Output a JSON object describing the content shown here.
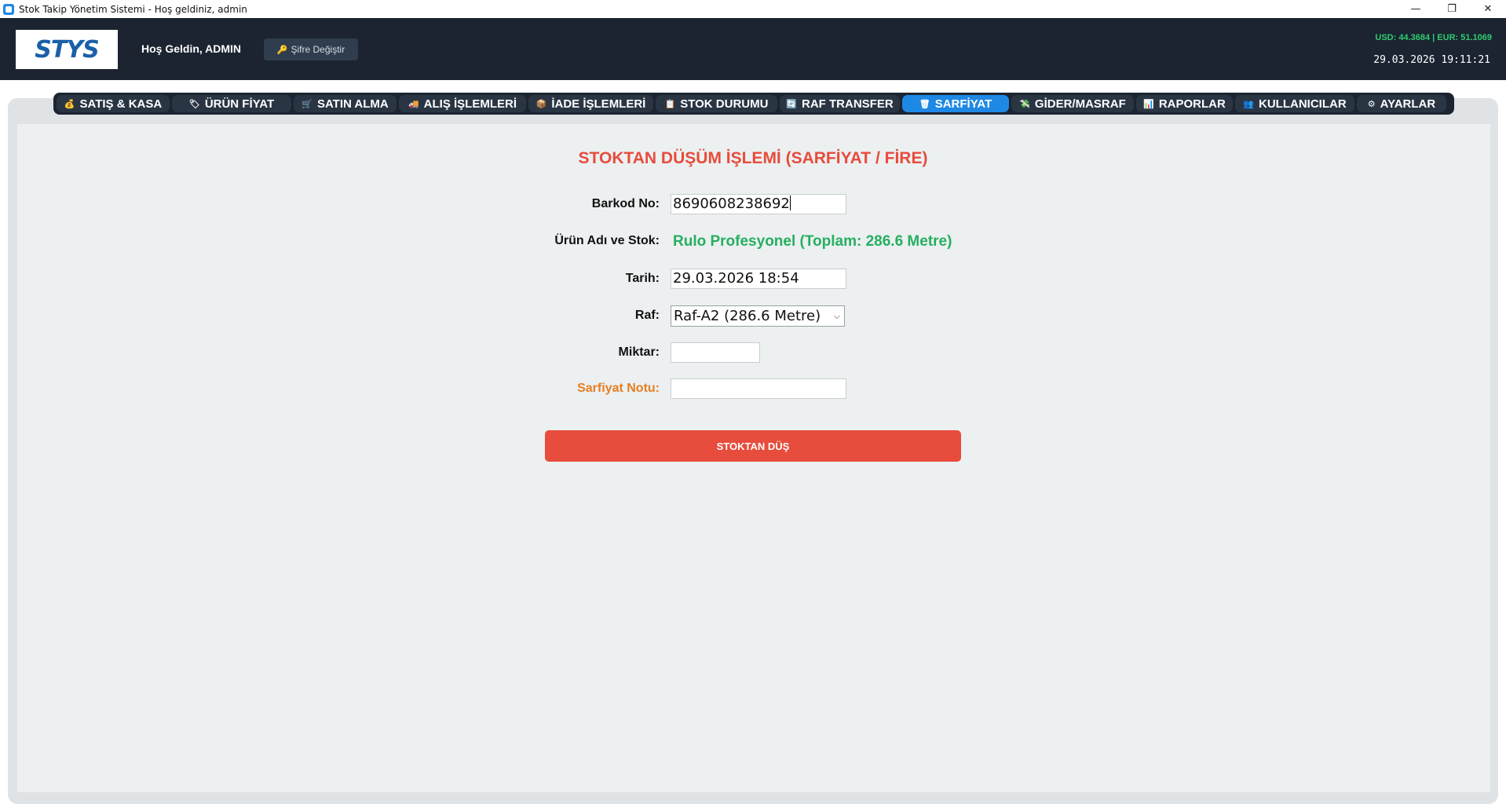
{
  "window": {
    "title": "Stok Takip Yönetim Sistemi - Hoş geldiniz, admin",
    "controls": {
      "minimize": "—",
      "restore": "❐",
      "close": "✕"
    }
  },
  "header": {
    "logo": "STYS",
    "welcome": "Hoş Geldin, ADMIN",
    "change_password": "Şifre Değiştir",
    "currency": "USD: 44.3684 | EUR: 51.1069",
    "datetime": "29.03.2026 19:11:21"
  },
  "nav": {
    "items": [
      {
        "label": "SATIŞ & KASA",
        "icon": "💰"
      },
      {
        "label": "ÜRÜN FİYAT",
        "icon": "🏷"
      },
      {
        "label": "SATIN ALMA",
        "icon": "🛒"
      },
      {
        "label": "ALIŞ İŞLEMLERİ",
        "icon": "🚚"
      },
      {
        "label": "İADE İŞLEMLERİ",
        "icon": "📦"
      },
      {
        "label": "STOK DURUMU",
        "icon": "📋"
      },
      {
        "label": "RAF TRANSFER",
        "icon": "🔄"
      },
      {
        "label": "SARFİYAT",
        "icon": "🗑"
      },
      {
        "label": "GİDER/MASRAF",
        "icon": "💸"
      },
      {
        "label": "RAPORLAR",
        "icon": "📊"
      },
      {
        "label": "KULLANICILAR",
        "icon": "👥"
      },
      {
        "label": "AYARLAR",
        "icon": "⚙"
      }
    ],
    "active": "SARFİYAT"
  },
  "form": {
    "title": "STOKTAN DÜŞÜM İŞLEMİ (SARFİYAT / FİRE)",
    "barcode_label": "Barkod No:",
    "barcode_value": "8690608238692",
    "product_label": "Ürün Adı ve Stok:",
    "product_value": "Rulo Profesyonel (Toplam: 286.6 Metre)",
    "date_label": "Tarih:",
    "date_value": "29.03.2026 18:54",
    "shelf_label": "Raf:",
    "shelf_value": "Raf-A2 (286.6 Metre)",
    "quantity_label": "Miktar:",
    "quantity_value": "",
    "note_label": "Sarfiyat Notu:",
    "note_value": "",
    "submit_label": "STOKTAN DÜŞ"
  },
  "colors": {
    "header_bg": "#1b2430",
    "accent_blue": "#1e88e5",
    "danger_red": "#e74c3c",
    "success_green": "#27ae60",
    "note_orange": "#e67e22"
  }
}
